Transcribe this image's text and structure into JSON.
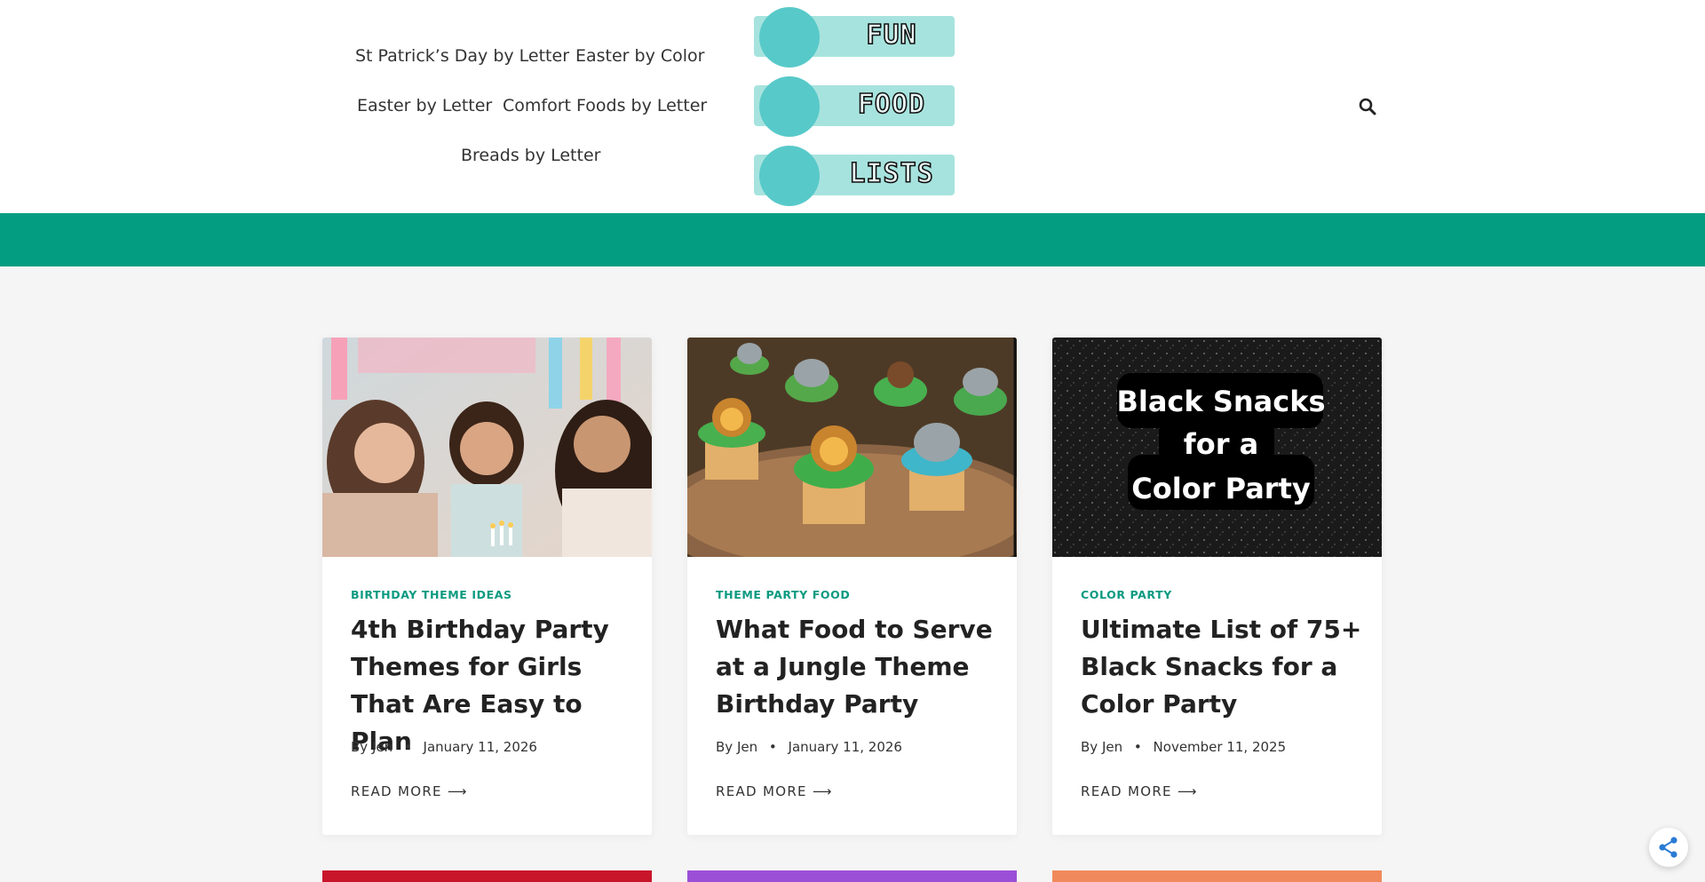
{
  "nav": {
    "items": [
      "St Patrick’s Day by Letter",
      "Easter by Color",
      "Easter by Letter",
      "Comfort Foods by Letter",
      "Breads by Letter"
    ]
  },
  "logo": {
    "words": [
      "FUN",
      "FOOD",
      "LISTS"
    ]
  },
  "header": {
    "search_icon": "search-icon"
  },
  "colors": {
    "accent": "#039e82",
    "category": "#0a9a80",
    "logo_pill": "#a7e3de",
    "logo_circle": "#58c9c9"
  },
  "posts": [
    {
      "category": "BIRTHDAY THEME IDEAS",
      "title": "4th Birthday Party Themes for Girls That Are Easy to Plan",
      "by": "By",
      "author": "Jen",
      "date": "January 11, 2026",
      "read_more": "READ MORE ⟶"
    },
    {
      "category": "THEME PARTY FOOD",
      "title": "What Food to Serve at a Jungle Theme Birthday Party",
      "by": "By",
      "author": "Jen",
      "date": "January 11, 2026",
      "read_more": "READ MORE ⟶"
    },
    {
      "category": "COLOR PARTY",
      "title": "Ultimate List of 75+ Black Snacks for a Color Party",
      "by": "By",
      "author": "Jen",
      "date": "November 11, 2025",
      "read_more": "READ MORE ⟶",
      "image_text": [
        "Black Snacks",
        "for a",
        "Color Party"
      ]
    }
  ],
  "share": {
    "icon": "share-icon"
  }
}
